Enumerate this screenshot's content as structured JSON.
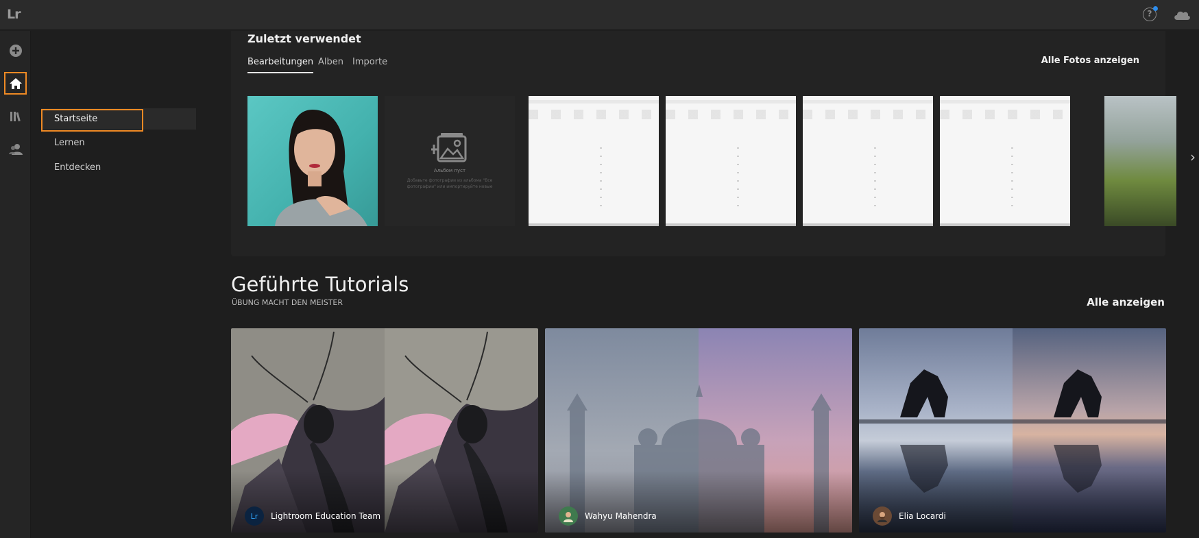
{
  "app": {
    "logo": "Lr"
  },
  "header": {
    "help_label": "?"
  },
  "sidebar": {
    "items": [
      {
        "label": "Startseite"
      },
      {
        "label": "Lernen"
      },
      {
        "label": "Entdecken"
      }
    ]
  },
  "recent": {
    "title": "Zuletzt verwendet",
    "tabs": [
      {
        "label": "Bearbeitungen"
      },
      {
        "label": "Alben"
      },
      {
        "label": "Importe"
      }
    ],
    "show_all": "Alle Fotos anzeigen",
    "album": {
      "empty_label": "Альбом пуст",
      "empty_hint": "Добавьте фотографии из альбома \"Все фотографии\" или импортируйте новые"
    }
  },
  "tutorials": {
    "title": "Geführte Tutorials",
    "subtitle": "ÜBUNG MACHT DEN MEISTER",
    "show_all": "Alle anzeigen",
    "cards": [
      {
        "author": "Lightroom Education Team",
        "avatar_text": "Lr"
      },
      {
        "author": "Wahyu Mahendra"
      },
      {
        "author": "Elia Locardi"
      }
    ]
  },
  "colors": {
    "accent": "#f08a24",
    "notification": "#2d8ceb",
    "background": "#1e1e1e"
  },
  "icons": [
    "add-icon",
    "home-icon",
    "library-icon",
    "people-icon",
    "help-icon",
    "cloud-icon",
    "chevron-right-icon",
    "empty-album-icon"
  ]
}
